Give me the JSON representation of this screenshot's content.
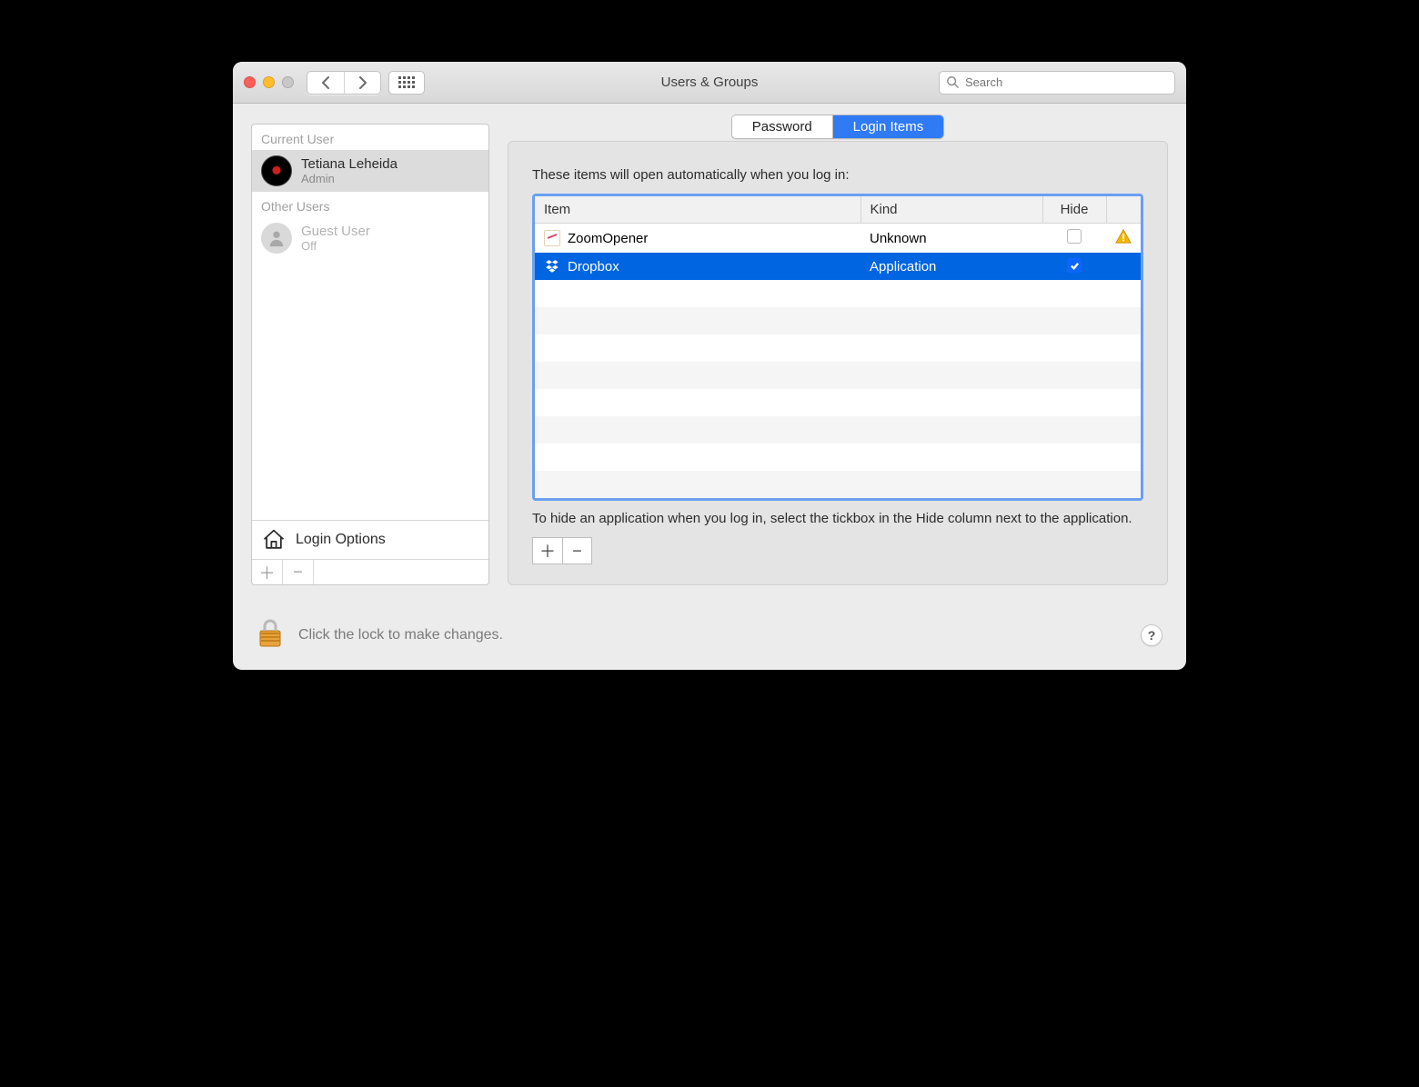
{
  "window": {
    "title": "Users & Groups"
  },
  "search": {
    "placeholder": "Search"
  },
  "sidebar": {
    "current_label": "Current User",
    "other_label": "Other Users",
    "current_user": {
      "name": "Tetiana Leheida",
      "role": "Admin"
    },
    "guest_user": {
      "name": "Guest User",
      "status": "Off"
    },
    "login_options_label": "Login Options"
  },
  "tabs": {
    "password": "Password",
    "login_items": "Login Items",
    "active": "login_items"
  },
  "login_items": {
    "intro": "These items will open automatically when you log in:",
    "columns": {
      "item": "Item",
      "kind": "Kind",
      "hide": "Hide"
    },
    "rows": [
      {
        "name": "ZoomOpener",
        "kind": "Unknown",
        "hide": false,
        "warning": true,
        "selected": false,
        "icon": "zoom"
      },
      {
        "name": "Dropbox",
        "kind": "Application",
        "hide": true,
        "warning": false,
        "selected": true,
        "icon": "dropbox"
      }
    ],
    "hint": "To hide an application when you log in, select the tickbox in the Hide column next to the application."
  },
  "footer": {
    "lock_text": "Click the lock to make changes."
  }
}
